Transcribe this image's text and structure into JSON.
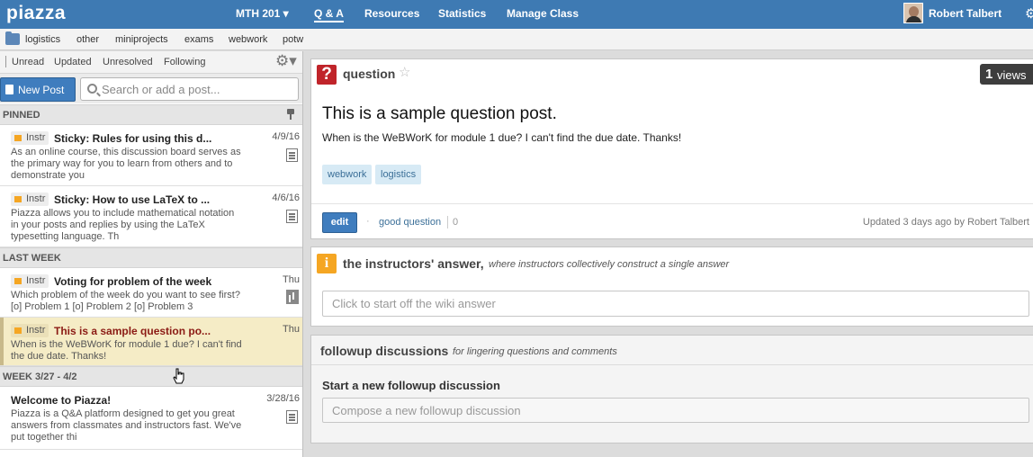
{
  "header": {
    "logo": "piazza",
    "nav": [
      "MTH 201 ▾",
      "Q & A",
      "Resources",
      "Statistics",
      "Manage Class"
    ],
    "user_name": "Robert Talbert"
  },
  "folders": [
    "logistics",
    "other",
    "miniprojects",
    "exams",
    "webwork",
    "potw"
  ],
  "filters": [
    "Unread",
    "Updated",
    "Unresolved",
    "Following"
  ],
  "toolbar": {
    "new_post_label": "New Post",
    "search_placeholder": "Search or add a post..."
  },
  "feed": {
    "groups": [
      "PINNED",
      "LAST WEEK",
      "WEEK 3/27 - 4/2"
    ],
    "instr_tag": "Instr",
    "posts": [
      {
        "title": "Sticky: Rules for using this d...",
        "date": "4/9/16",
        "snippet": "As an online course, this discussion board serves as the primary way for you to learn from others and to demonstrate you"
      },
      {
        "title": "Sticky: How to use LaTeX to ...",
        "date": "4/6/16",
        "snippet": "Piazza allows you to include mathematical notation in your posts and replies by using the LaTeX typesetting language. Th"
      },
      {
        "title": "Voting for problem of the week",
        "date": "Thu",
        "snippet": "Which problem of the week do you want to see first? [o] Problem 1 [o] Problem 2 [o] Problem 3"
      },
      {
        "title": "This is a sample question po...",
        "date": "Thu",
        "snippet": "When is the WeBWorK for module 1 due? I can't find the due date. Thanks!"
      },
      {
        "title": "Welcome to Piazza!",
        "date": "3/28/16",
        "snippet": "Piazza is a Q&A platform designed to get you great answers from classmates and instructors fast. We've put together thi"
      }
    ]
  },
  "question": {
    "type_label": "question",
    "views_count": "1",
    "views_label": "views",
    "title": "This is a sample question post.",
    "body": "When is the WeBWorK for module 1 due? I can't find the due date. Thanks!",
    "tags": [
      "webwork",
      "logistics"
    ],
    "edit_label": "edit",
    "good_question_label": "good question",
    "good_question_count": "0",
    "updated": "Updated 3 days ago by Robert Talbert"
  },
  "answer": {
    "title": "the instructors' answer,",
    "subtitle": "where instructors collectively construct a single answer",
    "placeholder": "Click to start off the wiki answer"
  },
  "followup": {
    "title": "followup discussions",
    "subtitle": "for lingering questions and comments",
    "start_label": "Start a new followup discussion",
    "placeholder": "Compose a new followup discussion"
  },
  "colors": {
    "topbar": "#3e7ab3",
    "accent_blue": "#3f7dbe",
    "question_red": "#c0242a",
    "instr_orange": "#f5a623",
    "selected_post": "#f5ecc6"
  }
}
